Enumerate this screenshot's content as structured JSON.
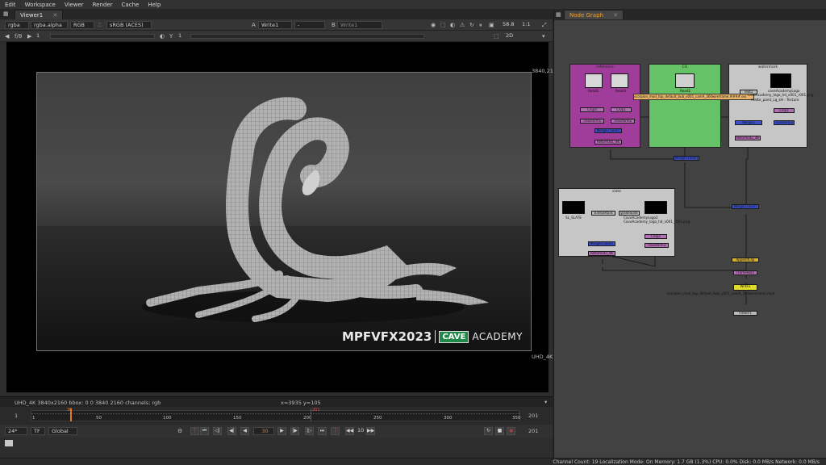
{
  "menu": [
    "Edit",
    "Workspace",
    "Viewer",
    "Render",
    "Cache",
    "Help"
  ],
  "viewer": {
    "tab_label": "Viewer1",
    "controls": {
      "channels": "rgba",
      "alpha": "rgba.alpha",
      "colorspace_mode": "RGB",
      "display": "sRGB (ACES)",
      "input_a_letter": "A",
      "input_a": "Write1",
      "input_a_op": "-",
      "input_b_letter": "B",
      "input_b": "Write1",
      "zoom": "58.8",
      "ratio": "1:1",
      "fstop": "f/8",
      "frame_field": "1",
      "gain": "1",
      "y_label": "Y",
      "gamma": "1",
      "view_mode": "2D"
    },
    "format_top_right": "3840,21",
    "format_bottom_right": "UHD_4K",
    "watermark_left": "MPFVFX2023",
    "watermark_cave": "CAVE",
    "watermark_academy": "ACADEMY",
    "info_left": "UHD_4K 3840x2160  bbox: 0 0 3840 2160  channels: rgb",
    "info_coords": "x=3935 y=105"
  },
  "timeline": {
    "start": "1",
    "end": "201",
    "current_marker": "30",
    "end_marker": "201",
    "ticks": [
      "1",
      "50",
      "100",
      "150",
      "200",
      "250",
      "300",
      "350"
    ],
    "play_fps": "24*",
    "tf": "TF",
    "range_mode": "Global",
    "current_frame": "30",
    "step": "10",
    "end_frame_right": "201"
  },
  "nodegraph": {
    "tab_label": "Node Graph",
    "backdrops": {
      "reference": "reference",
      "cg": "CG",
      "watermark": "watermark",
      "slate": "slate"
    },
    "nodes": {
      "read2": "Read2",
      "read3": "Read3",
      "read1": "Read1",
      "read1_file": "scorpion_mod_top_default_bub_v001_camA_360wireframe.####.exr",
      "crop1": "Crop1",
      "crop4": "Crop4",
      "transform1": "Transform1",
      "transform2": "Transform2",
      "merge_reference": "Merge2 (over)",
      "reformat1": "Reformat1_4K",
      "cave_logo": "caveAcademyLogo",
      "cave_logo_file": "caveAcademy_logo_hd_v001_r001.png",
      "matte_paint": "matte_paint_Lg_kH - Tecture",
      "text1": "Text1",
      "merge3": "Merge3",
      "reformat2": "Reformat2_4K",
      "slate_name": "SL_SLATE",
      "slate_details": "slateDetails",
      "grad_slate": "gradeSlate",
      "cave_logo2": "CaveAcademyLogo2",
      "cave_logo2_file": "CaveAcademy_logo_hd_v001_r001.png",
      "crop2": "Crop2",
      "transform3": "Transform3",
      "merge_slate": "Merge4 (over)",
      "reformat3": "Reformat3_4K",
      "merge_final": "Merge5 (over)",
      "append_clip": "AppendClip",
      "frame_hold": "FrameHold",
      "write1": "Write1",
      "write_file": "scorpion_mod_top_default_bub_v001_camA_360wireframe.mp4",
      "viewer1": "Viewer1"
    }
  },
  "status": {
    "text": "Channel Count: 19  Localization Mode: On  Memory: 1.7 GB (1.3%)  CPU: 0.0%  Disk: 0.0 MB/s  Network: 0.0 MB/s"
  },
  "colors": {
    "reference_backdrop": "#a03c9a",
    "cg_backdrop": "#66c266",
    "gray_backdrop": "#c6c6c6",
    "merge_node": "#3a4ec8",
    "transform_node": "#b36fb3",
    "read_node": "#bbbbbb",
    "write_node": "#e1dc2a",
    "playhead": "#e8761a",
    "cave_green": "#1f8a47"
  }
}
